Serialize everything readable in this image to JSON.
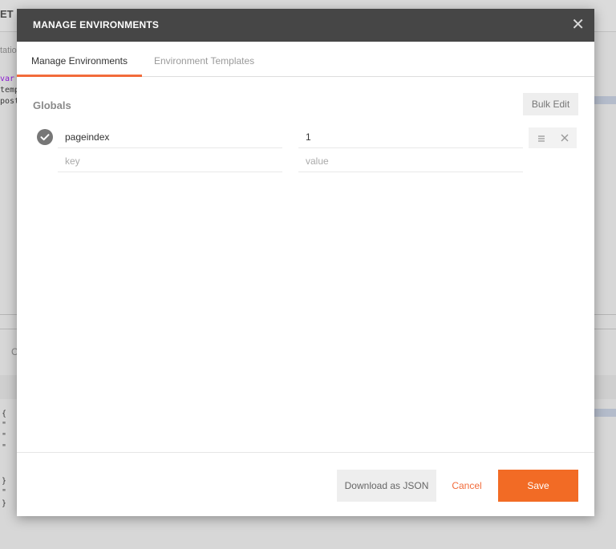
{
  "background": {
    "method_fragment": "ET",
    "sub_fragment": "tatio",
    "code_lines": [
      "var",
      "temp",
      "post"
    ],
    "c_label": "C",
    "code2_lines": [
      "{",
      "\"",
      "\"",
      "\"",
      "",
      "",
      "}",
      "\"",
      "}"
    ]
  },
  "modal": {
    "title": "MANAGE ENVIRONMENTS",
    "close_icon": "close-icon",
    "tabs": [
      {
        "label": "Manage Environments",
        "active": true
      },
      {
        "label": "Environment Templates",
        "active": false
      }
    ],
    "section_title": "Globals",
    "bulk_edit_label": "Bulk Edit",
    "rows": [
      {
        "key": "pageindex",
        "value": "1",
        "enabled": true
      },
      {
        "key_placeholder": "key",
        "value_placeholder": "value"
      }
    ],
    "row_icons": {
      "enabled": "check-icon",
      "menu": "menu-icon",
      "delete": "delete-icon"
    },
    "footer": {
      "download_label": "Download as JSON",
      "cancel_label": "Cancel",
      "save_label": "Save"
    }
  },
  "colors": {
    "header_bg": "#464646",
    "accent": "#f26b25",
    "tab_underline": "#f26b3a"
  }
}
